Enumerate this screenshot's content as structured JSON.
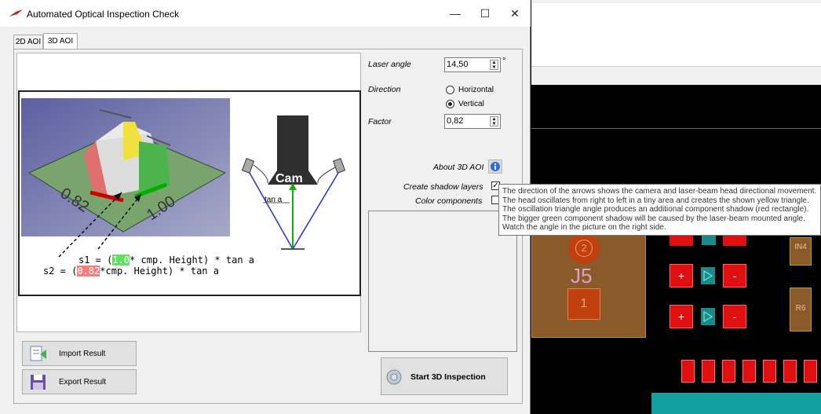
{
  "window": {
    "title": "Automated Optical Inspection Check",
    "minimize": "—",
    "maximize": "☐",
    "close": "✕"
  },
  "tabs": [
    {
      "label": "2D AOI"
    },
    {
      "label": "3D AOI"
    }
  ],
  "diagram": {
    "eq1_prefix": "s1 =  (",
    "eq1_factor": "1.0",
    "eq1_suffix": "*  cmp. Height) * tan a",
    "eq2_prefix": "s2 =  (",
    "eq2_factor": "0.82",
    "eq2_suffix": "*cmp. Height) * tan a",
    "label_082": "0.82",
    "label_100": "1.00",
    "cam_label": "Cam",
    "tan_label": "tan a"
  },
  "settings": {
    "laser_angle_label": "Laser angle",
    "laser_angle_value": "14,50",
    "laser_angle_unit": "°",
    "direction_label": "Direction",
    "direction_options": [
      {
        "label": "Horizontal",
        "selected": false
      },
      {
        "label": "Vertical",
        "selected": true
      }
    ],
    "factor_label": "Factor",
    "factor_value": "0,82",
    "about_label": "About 3D AOI",
    "shadow_label": "Create shadow layers",
    "shadow_checked": true,
    "color_label": "Color components",
    "color_checked": false
  },
  "tooltip": {
    "lines": [
      "The direction of the arrows shows the camera and laser-beam head directional movement.",
      "The head oscillates from right to left in a tiny area and creates the shown yellow triangle.",
      "The oscillation triangle angle produces an additional component shadow (red rectangle).",
      "The bigger green component shadow will be caused by the laser-beam mounted angle.",
      "Watch the angle in the picture on the right side."
    ]
  },
  "buttons": {
    "import_label": "Import Result",
    "export_label": "Export Result",
    "start_label": "Start 3D Inspection"
  },
  "board": {
    "j5_label": "J5",
    "pad2_label": "2",
    "pad1_label": "1",
    "in4_label": "IN4",
    "r6_label": "R6",
    "plus": "+",
    "minus": "-"
  }
}
